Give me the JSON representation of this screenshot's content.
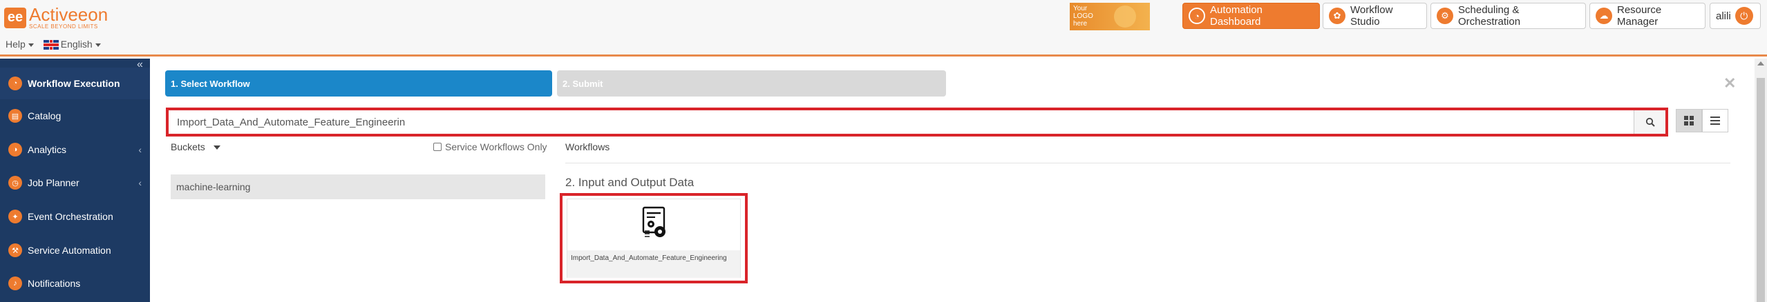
{
  "brand": {
    "name": "Activeeon",
    "tagline": "SCALE BEYOND LIMITS",
    "mark": "ee"
  },
  "header": {
    "help_label": "Help",
    "language_label": "English",
    "your_logo_text": "Your\nLOGO\nhere",
    "nav": [
      {
        "label": "Automation Dashboard",
        "icon": "dashboard-gauge-icon",
        "active": true
      },
      {
        "label": "Workflow Studio",
        "icon": "workflow-studio-icon",
        "active": false
      },
      {
        "label": "Scheduling & Orchestration",
        "icon": "scheduler-icon",
        "active": false
      },
      {
        "label": "Resource Manager",
        "icon": "cloud-icon",
        "active": false
      }
    ],
    "user": "alili"
  },
  "sidebar": {
    "items": [
      {
        "label": "Workflow Execution",
        "icon": "gauge-icon",
        "active": true,
        "expandable": false
      },
      {
        "label": "Catalog",
        "icon": "catalog-icon",
        "active": false,
        "expandable": false
      },
      {
        "label": "Analytics",
        "icon": "analytics-icon",
        "active": false,
        "expandable": true
      },
      {
        "label": "Job Planner",
        "icon": "clock-icon",
        "active": false,
        "expandable": true
      },
      {
        "label": "Event Orchestration",
        "icon": "event-icon",
        "active": false,
        "expandable": false
      },
      {
        "label": "Service Automation",
        "icon": "service-icon",
        "active": false,
        "expandable": false
      },
      {
        "label": "Notifications",
        "icon": "bell-icon",
        "active": false,
        "expandable": false
      }
    ]
  },
  "wizard": {
    "steps": [
      "1. Select Workflow",
      "2. Submit"
    ],
    "search_value": "Import_Data_And_Automate_Feature_Engineerin",
    "buckets_label": "Buckets",
    "service_only_label": "Service Workflows Only",
    "workflows_label": "Workflows",
    "buckets": [
      "machine-learning"
    ],
    "group_title": "2. Input and Output Data",
    "workflow_cards": [
      {
        "name": "Import_Data_And_Automate_Feature_Engineering",
        "icon": "workflow-gears-icon"
      }
    ]
  },
  "colors": {
    "accent": "#ee7b2f",
    "sidebar": "#1d3a63",
    "step_active": "#1b87c9",
    "highlight": "#d9242a"
  }
}
